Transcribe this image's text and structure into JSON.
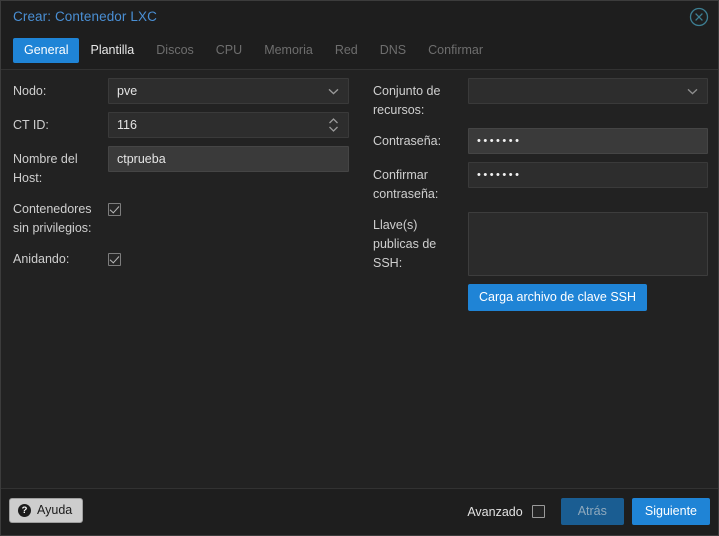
{
  "window": {
    "title": "Crear: Contenedor LXC",
    "close_icon": "close-circle-icon"
  },
  "tabs": [
    {
      "label": "General",
      "state": "active"
    },
    {
      "label": "Plantilla",
      "state": "enabled"
    },
    {
      "label": "Discos",
      "state": "disabled"
    },
    {
      "label": "CPU",
      "state": "disabled"
    },
    {
      "label": "Memoria",
      "state": "disabled"
    },
    {
      "label": "Red",
      "state": "disabled"
    },
    {
      "label": "DNS",
      "state": "disabled"
    },
    {
      "label": "Confirmar",
      "state": "disabled"
    }
  ],
  "form": {
    "left": {
      "node": {
        "label": "Nodo:",
        "value": "pve",
        "icon": "chevron-down-icon"
      },
      "ctid": {
        "label": "CT ID:",
        "value": "116",
        "icon": "spinner-updown-icon"
      },
      "hostname": {
        "label": "Nombre del Host:",
        "value": "ctprueba"
      },
      "unprivileged": {
        "label": "Contenedores sin privilegios:",
        "checked": true
      },
      "nesting": {
        "label": "Anidando:",
        "checked": true
      }
    },
    "right": {
      "pool": {
        "label": "Conjunto de recursos:",
        "value": "",
        "icon": "chevron-down-icon"
      },
      "password": {
        "label": "Contraseña:",
        "value": "•••••••"
      },
      "password_confirm": {
        "label": "Confirmar contraseña:",
        "value": "•••••••"
      },
      "ssh_keys": {
        "label": "Llave(s) publicas de SSH:",
        "value": ""
      },
      "ssh_upload_button": {
        "label": "Carga archivo de clave SSH"
      }
    }
  },
  "footer": {
    "help": {
      "label": "Ayuda",
      "icon": "question-mark-icon"
    },
    "advanced": {
      "label": "Avanzado",
      "checked": false
    },
    "back": {
      "label": "Atrás",
      "disabled": true
    },
    "next": {
      "label": "Siguiente",
      "disabled": false
    }
  },
  "colors": {
    "accent_blue": "#1f84d6",
    "title_blue": "#4a8fd4",
    "window_bg": "#222222",
    "bar_bg": "#1e1e1e",
    "input_bg": "#2d2d2d",
    "input_bg_focus": "#3a3a3a",
    "label_text": "#cfcfcf",
    "disabled_tab_text": "#6e6e6e"
  }
}
